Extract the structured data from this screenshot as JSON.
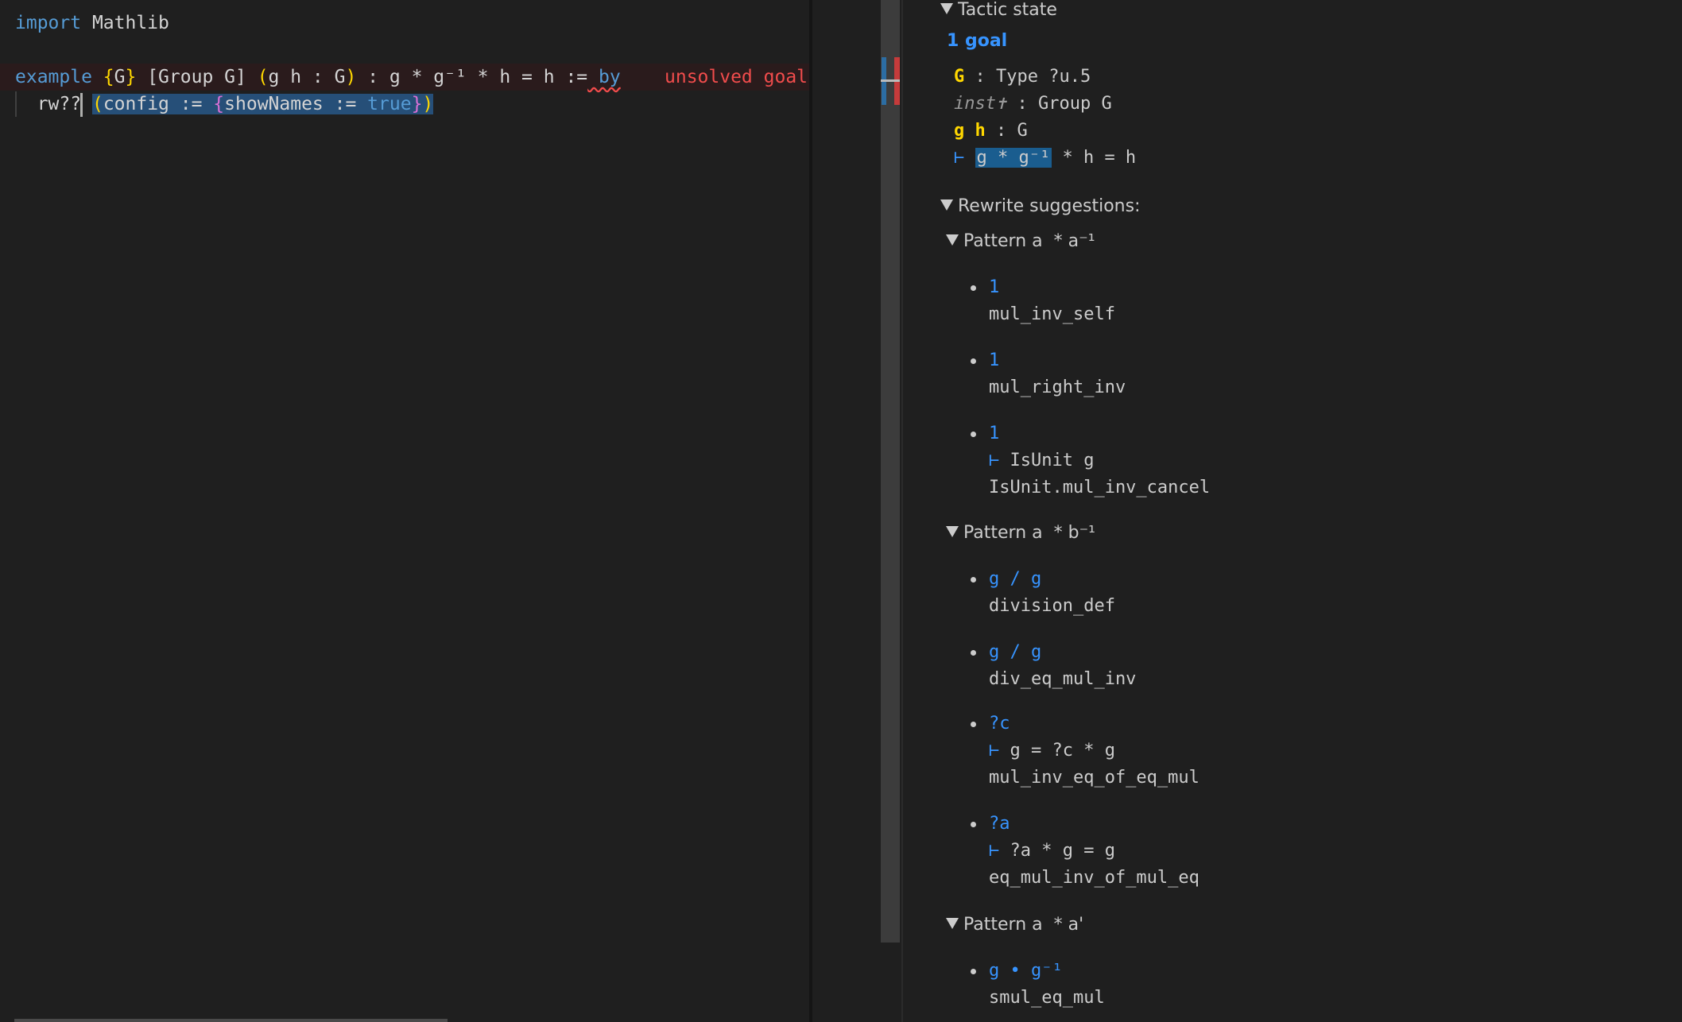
{
  "editor": {
    "line1": {
      "import_kw": "import",
      "module": " Mathlib"
    },
    "line2": {
      "example_kw": "example",
      "brace_open": " {",
      "g_var": "G",
      "brace_close": "}",
      "bracket_group": " [Group G]",
      "paren_open": " (",
      "binders": "g h : G",
      "paren_close": ")",
      "statement": " : g * g⁻¹ * h = h :=",
      "by_kw": " by",
      "diagnostic": "unsolved goals"
    },
    "line3": {
      "tactic": "rw??",
      "config_paren_open": "(",
      "config_kw": "config",
      "assign1": " := ",
      "brace_open": "{",
      "show_names": "showNames",
      "assign2": " := ",
      "true_kw": "true",
      "brace_close": "}",
      "config_paren_close": ")"
    }
  },
  "infoview": {
    "tactic_state_label": "Tactic state",
    "goal_count": "1 goal",
    "hyps": [
      {
        "names": "G",
        "sep": " : ",
        "type": "Type ?u.5"
      },
      {
        "names": "inst✝",
        "sep": " : ",
        "type": "Group G"
      },
      {
        "names": "g h",
        "sep": " : ",
        "type": "G"
      }
    ],
    "goal": {
      "turnstile": "⊢",
      "highlighted": "g * g⁻¹",
      "rest": " * h = h"
    },
    "rewrite_label": "Rewrite suggestions:",
    "patterns": [
      {
        "label": "Pattern a  * a⁻¹",
        "items": [
          {
            "result": "1",
            "lemma": "mul_inv_self"
          },
          {
            "result": "1",
            "lemma": "mul_right_inv"
          },
          {
            "result": "1",
            "side_goal": "IsUnit g",
            "lemma": "IsUnit.mul_inv_cancel"
          }
        ]
      },
      {
        "label": "Pattern a  * b⁻¹",
        "items": [
          {
            "result": "g / g",
            "lemma": "division_def"
          },
          {
            "result": "g / g",
            "lemma": "div_eq_mul_inv"
          },
          {
            "result": "?c",
            "side_goal": "g = ?c * g",
            "lemma": "mul_inv_eq_of_eq_mul"
          },
          {
            "result": "?a",
            "side_goal": "?a * g = g",
            "lemma": "eq_mul_inv_of_mul_eq"
          }
        ]
      },
      {
        "label": "Pattern a  * a'",
        "items": [
          {
            "result": "g • g⁻¹",
            "lemma": "smul_eq_mul"
          }
        ]
      }
    ]
  }
}
